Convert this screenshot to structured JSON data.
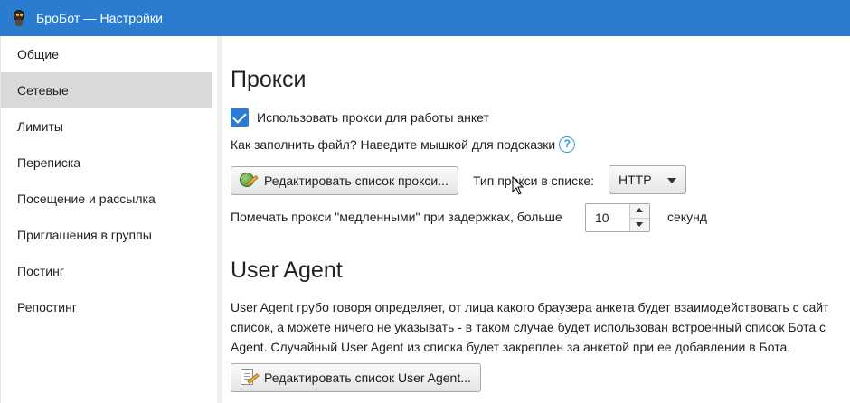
{
  "window": {
    "title": "БроБот — Настройки",
    "accent": "#2b7bd1"
  },
  "sidebar": {
    "items": [
      {
        "label": "Общие",
        "active": false
      },
      {
        "label": "Сетевые",
        "active": true
      },
      {
        "label": "Лимиты",
        "active": false
      },
      {
        "label": "Переписка",
        "active": false
      },
      {
        "label": "Посещение и рассылка",
        "active": false
      },
      {
        "label": "Приглашения в группы",
        "active": false
      },
      {
        "label": "Постинг",
        "active": false
      },
      {
        "label": "Репостинг",
        "active": false
      }
    ]
  },
  "proxy": {
    "title": "Прокси",
    "use_proxy_label": "Использовать прокси для работы анкет",
    "use_proxy_checked": true,
    "hint_text": "Как заполнить файл? Наведите мышкой для подсказки",
    "help_icon": "?",
    "edit_button_label": "Редактировать список прокси...",
    "type_label": "Тип прокси в списке:",
    "type_value": "HTTP",
    "slow_label": "Помечать прокси \"медленными\" при задержках, больше",
    "slow_value": "10",
    "slow_unit": "секунд"
  },
  "user_agent": {
    "title": "User Agent",
    "description_lines": [
      "User Agent грубо говоря определяет, от лица какого браузера анкета будет взаимодействовать с сайт",
      "список, а можете ничего не указывать - в таком случае будет использован встроенный список Бота с",
      "Agent. Случайный User Agent из списка будет закреплен за анкетой при ее добавлении в Бота."
    ],
    "edit_button_label": "Редактировать список User Agent..."
  }
}
